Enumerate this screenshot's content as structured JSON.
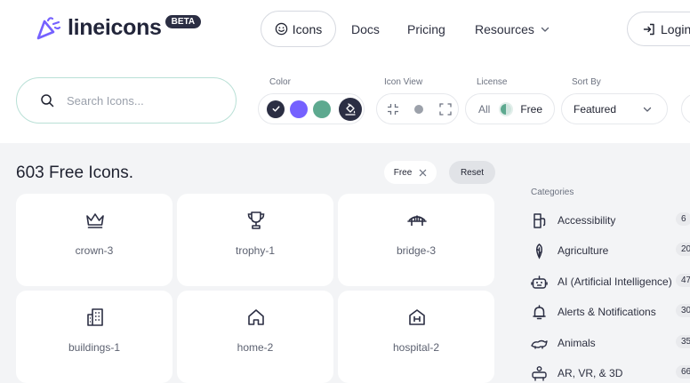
{
  "brand": {
    "name": "lineicons",
    "badge": "BETA",
    "accent": "#7561ff"
  },
  "nav": {
    "active": "Icons",
    "docs": "Docs",
    "pricing": "Pricing",
    "resources": "Resources",
    "login": "Login"
  },
  "search": {
    "placeholder": "Search Icons...",
    "value": ""
  },
  "filters": {
    "color_label": "Color",
    "colors": [
      "#2b2e43",
      "#7561ff",
      "#5da98f"
    ],
    "selected_color": "#2b2e43",
    "view_label": "Icon View",
    "license_label": "License",
    "license_all": "All",
    "license_free": "Free",
    "sort_label": "Sort By",
    "sort_value": "Featured"
  },
  "results": {
    "title": "603 Free Icons.",
    "chip_free": "Free",
    "reset": "Reset"
  },
  "icons": [
    {
      "name": "crown-3",
      "icon": "crown-icon"
    },
    {
      "name": "trophy-1",
      "icon": "trophy-icon"
    },
    {
      "name": "bridge-3",
      "icon": "bridge-icon"
    },
    {
      "name": "buildings-1",
      "icon": "buildings-icon"
    },
    {
      "name": "home-2",
      "icon": "home-icon"
    },
    {
      "name": "hospital-2",
      "icon": "hospital-icon"
    }
  ],
  "categories": {
    "title": "Categories",
    "items": [
      {
        "label": "Accessibility",
        "count": "6",
        "icon": "accessibility-icon"
      },
      {
        "label": "Agriculture",
        "count": "20",
        "icon": "agriculture-icon"
      },
      {
        "label": "AI (Artificial Intelligence)",
        "count": "47",
        "icon": "robot-icon"
      },
      {
        "label": "Alerts & Notifications",
        "count": "30",
        "icon": "alarm-icon"
      },
      {
        "label": "Animals",
        "count": "35",
        "icon": "animal-icon"
      },
      {
        "label": "AR, VR, & 3D",
        "count": "66",
        "icon": "vr-icon"
      }
    ]
  }
}
